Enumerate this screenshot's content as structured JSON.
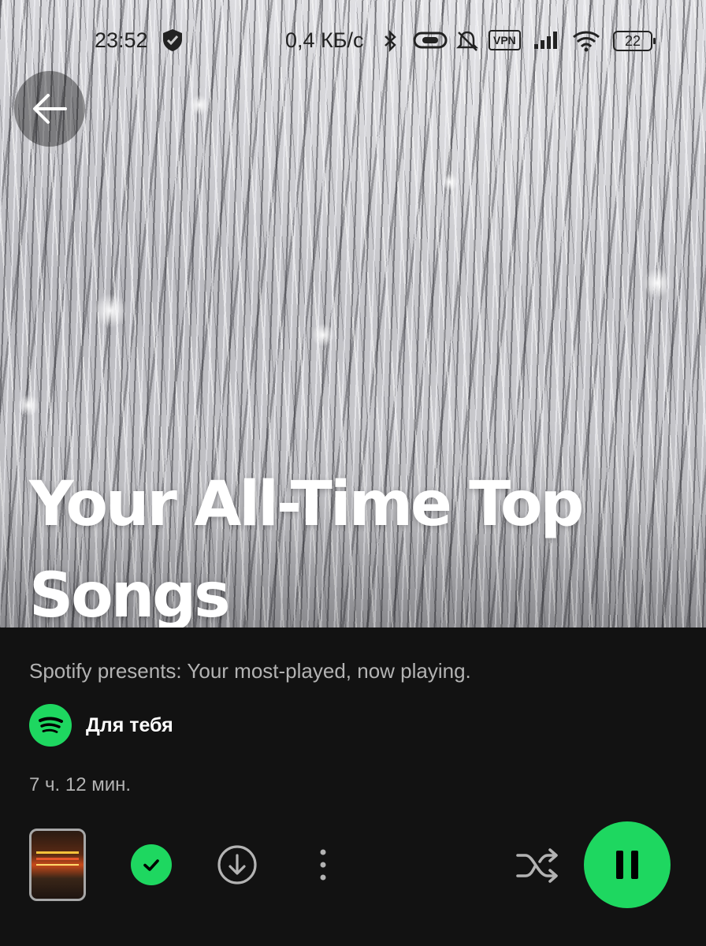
{
  "status_bar": {
    "time": "23:52",
    "net_speed": "0,4 КБ/с",
    "vpn_label": "VPN",
    "battery": "22"
  },
  "playlist": {
    "title": "Your All-Time Top Songs",
    "description": "Spotify presents: Your most-played, now playing.",
    "owner": "Для тебя",
    "duration": "7 ч. 12 мин."
  },
  "colors": {
    "accent": "#1ed760",
    "background": "#121212",
    "secondary_text": "#b3b3b3"
  },
  "icons": {
    "back": "arrow-left-icon",
    "added": "check-circle-icon",
    "download": "download-circle-icon",
    "more": "more-vertical-icon",
    "shuffle": "shuffle-icon",
    "play_state": "pause-icon"
  }
}
